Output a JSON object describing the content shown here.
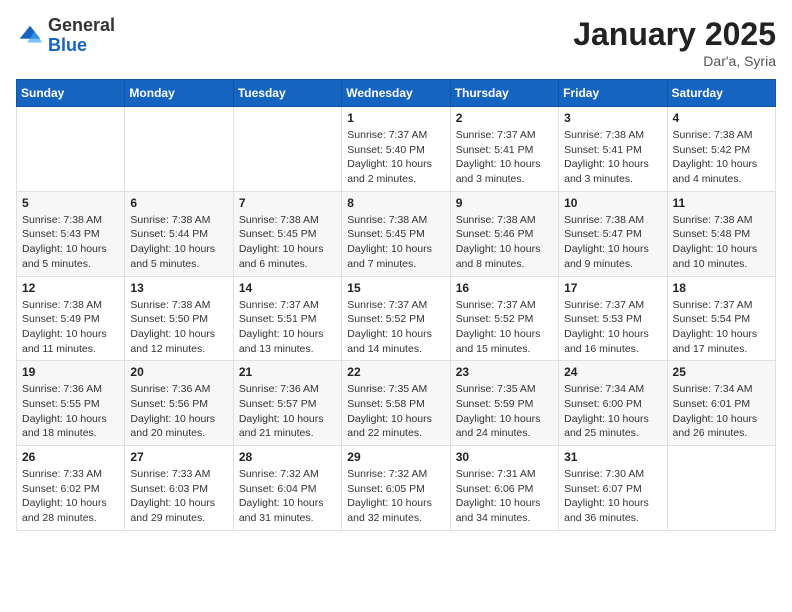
{
  "logo": {
    "general": "General",
    "blue": "Blue"
  },
  "title": "January 2025",
  "subtitle": "Dar'a, Syria",
  "weekdays": [
    "Sunday",
    "Monday",
    "Tuesday",
    "Wednesday",
    "Thursday",
    "Friday",
    "Saturday"
  ],
  "weeks": [
    [
      {
        "day": "",
        "info": ""
      },
      {
        "day": "",
        "info": ""
      },
      {
        "day": "",
        "info": ""
      },
      {
        "day": "1",
        "info": "Sunrise: 7:37 AM\nSunset: 5:40 PM\nDaylight: 10 hours and 2 minutes."
      },
      {
        "day": "2",
        "info": "Sunrise: 7:37 AM\nSunset: 5:41 PM\nDaylight: 10 hours and 3 minutes."
      },
      {
        "day": "3",
        "info": "Sunrise: 7:38 AM\nSunset: 5:41 PM\nDaylight: 10 hours and 3 minutes."
      },
      {
        "day": "4",
        "info": "Sunrise: 7:38 AM\nSunset: 5:42 PM\nDaylight: 10 hours and 4 minutes."
      }
    ],
    [
      {
        "day": "5",
        "info": "Sunrise: 7:38 AM\nSunset: 5:43 PM\nDaylight: 10 hours and 5 minutes."
      },
      {
        "day": "6",
        "info": "Sunrise: 7:38 AM\nSunset: 5:44 PM\nDaylight: 10 hours and 5 minutes."
      },
      {
        "day": "7",
        "info": "Sunrise: 7:38 AM\nSunset: 5:45 PM\nDaylight: 10 hours and 6 minutes."
      },
      {
        "day": "8",
        "info": "Sunrise: 7:38 AM\nSunset: 5:45 PM\nDaylight: 10 hours and 7 minutes."
      },
      {
        "day": "9",
        "info": "Sunrise: 7:38 AM\nSunset: 5:46 PM\nDaylight: 10 hours and 8 minutes."
      },
      {
        "day": "10",
        "info": "Sunrise: 7:38 AM\nSunset: 5:47 PM\nDaylight: 10 hours and 9 minutes."
      },
      {
        "day": "11",
        "info": "Sunrise: 7:38 AM\nSunset: 5:48 PM\nDaylight: 10 hours and 10 minutes."
      }
    ],
    [
      {
        "day": "12",
        "info": "Sunrise: 7:38 AM\nSunset: 5:49 PM\nDaylight: 10 hours and 11 minutes."
      },
      {
        "day": "13",
        "info": "Sunrise: 7:38 AM\nSunset: 5:50 PM\nDaylight: 10 hours and 12 minutes."
      },
      {
        "day": "14",
        "info": "Sunrise: 7:37 AM\nSunset: 5:51 PM\nDaylight: 10 hours and 13 minutes."
      },
      {
        "day": "15",
        "info": "Sunrise: 7:37 AM\nSunset: 5:52 PM\nDaylight: 10 hours and 14 minutes."
      },
      {
        "day": "16",
        "info": "Sunrise: 7:37 AM\nSunset: 5:52 PM\nDaylight: 10 hours and 15 minutes."
      },
      {
        "day": "17",
        "info": "Sunrise: 7:37 AM\nSunset: 5:53 PM\nDaylight: 10 hours and 16 minutes."
      },
      {
        "day": "18",
        "info": "Sunrise: 7:37 AM\nSunset: 5:54 PM\nDaylight: 10 hours and 17 minutes."
      }
    ],
    [
      {
        "day": "19",
        "info": "Sunrise: 7:36 AM\nSunset: 5:55 PM\nDaylight: 10 hours and 18 minutes."
      },
      {
        "day": "20",
        "info": "Sunrise: 7:36 AM\nSunset: 5:56 PM\nDaylight: 10 hours and 20 minutes."
      },
      {
        "day": "21",
        "info": "Sunrise: 7:36 AM\nSunset: 5:57 PM\nDaylight: 10 hours and 21 minutes."
      },
      {
        "day": "22",
        "info": "Sunrise: 7:35 AM\nSunset: 5:58 PM\nDaylight: 10 hours and 22 minutes."
      },
      {
        "day": "23",
        "info": "Sunrise: 7:35 AM\nSunset: 5:59 PM\nDaylight: 10 hours and 24 minutes."
      },
      {
        "day": "24",
        "info": "Sunrise: 7:34 AM\nSunset: 6:00 PM\nDaylight: 10 hours and 25 minutes."
      },
      {
        "day": "25",
        "info": "Sunrise: 7:34 AM\nSunset: 6:01 PM\nDaylight: 10 hours and 26 minutes."
      }
    ],
    [
      {
        "day": "26",
        "info": "Sunrise: 7:33 AM\nSunset: 6:02 PM\nDaylight: 10 hours and 28 minutes."
      },
      {
        "day": "27",
        "info": "Sunrise: 7:33 AM\nSunset: 6:03 PM\nDaylight: 10 hours and 29 minutes."
      },
      {
        "day": "28",
        "info": "Sunrise: 7:32 AM\nSunset: 6:04 PM\nDaylight: 10 hours and 31 minutes."
      },
      {
        "day": "29",
        "info": "Sunrise: 7:32 AM\nSunset: 6:05 PM\nDaylight: 10 hours and 32 minutes."
      },
      {
        "day": "30",
        "info": "Sunrise: 7:31 AM\nSunset: 6:06 PM\nDaylight: 10 hours and 34 minutes."
      },
      {
        "day": "31",
        "info": "Sunrise: 7:30 AM\nSunset: 6:07 PM\nDaylight: 10 hours and 36 minutes."
      },
      {
        "day": "",
        "info": ""
      }
    ]
  ]
}
